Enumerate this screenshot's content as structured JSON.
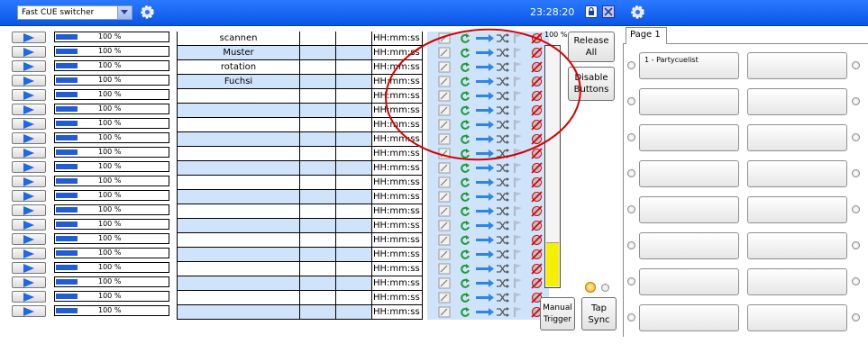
{
  "header": {
    "mode_select_value": "Fast CUE switcher",
    "clock": "23:28:20",
    "icons": [
      "settings-gear-icon",
      "lock-icon",
      "close-icon",
      "settings-gear-icon"
    ],
    "bar_color": "#1560f0"
  },
  "cue_rows": [
    {
      "volume_percent": 100,
      "volume_label": "100  %",
      "name": "scannen",
      "time": "HH:mm:ss"
    },
    {
      "volume_percent": 100,
      "volume_label": "100  %",
      "name": "Muster",
      "time": "HH:mm:ss"
    },
    {
      "volume_percent": 100,
      "volume_label": "100  %",
      "name": "rotation",
      "time": "HH:mm:ss"
    },
    {
      "volume_percent": 100,
      "volume_label": "100  %",
      "name": "Fuchsi",
      "time": "HH:mm:ss"
    },
    {
      "volume_percent": 100,
      "volume_label": "100  %",
      "name": "",
      "time": "HH:mm:ss"
    },
    {
      "volume_percent": 100,
      "volume_label": "100  %",
      "name": "",
      "time": "HH:mm:ss"
    },
    {
      "volume_percent": 100,
      "volume_label": "100  %",
      "name": "",
      "time": "HH:mm:ss"
    },
    {
      "volume_percent": 100,
      "volume_label": "100  %",
      "name": "",
      "time": "HH:mm:ss"
    },
    {
      "volume_percent": 100,
      "volume_label": "100  %",
      "name": "",
      "time": "HH:mm:ss"
    },
    {
      "volume_percent": 100,
      "volume_label": "100  %",
      "name": "",
      "time": "HH:mm:ss"
    },
    {
      "volume_percent": 100,
      "volume_label": "100  %",
      "name": "",
      "time": "HH:mm:ss"
    },
    {
      "volume_percent": 100,
      "volume_label": "100  %",
      "name": "",
      "time": "HH:mm:ss"
    },
    {
      "volume_percent": 100,
      "volume_label": "100  %",
      "name": "",
      "time": "HH:mm:ss"
    },
    {
      "volume_percent": 100,
      "volume_label": "100  %",
      "name": "",
      "time": "HH:mm:ss"
    },
    {
      "volume_percent": 100,
      "volume_label": "100  %",
      "name": "",
      "time": "HH:mm:ss"
    },
    {
      "volume_percent": 100,
      "volume_label": "100  %",
      "name": "",
      "time": "HH:mm:ss"
    },
    {
      "volume_percent": 100,
      "volume_label": "100  %",
      "name": "",
      "time": "HH:mm:ss"
    },
    {
      "volume_percent": 100,
      "volume_label": "100  %",
      "name": "",
      "time": "HH:mm:ss"
    },
    {
      "volume_percent": 100,
      "volume_label": "100  %",
      "name": "",
      "time": "HH:mm:ss"
    },
    {
      "volume_percent": 100,
      "volume_label": "100  %",
      "name": "",
      "time": "HH:mm:ss"
    }
  ],
  "row_icons": [
    "edit-icon",
    "refresh-icon",
    "forward-arrow-icon",
    "shuffle-icon",
    "flag-icon",
    "disable-icon"
  ],
  "master": {
    "level_label": "100 %",
    "level_fraction": 0.18,
    "release_all_label": [
      "Release",
      "All"
    ],
    "disable_buttons_label": [
      "Disable",
      "Buttons"
    ],
    "manual_trigger_label": [
      "Manual",
      "Trigger"
    ],
    "tap_sync_label": [
      "Tap",
      "Sync"
    ]
  },
  "cuelists": {
    "tab_label": "Page 1",
    "buttons": [
      [
        "1 - Partycuelist",
        ""
      ],
      [
        "",
        ""
      ],
      [
        "",
        ""
      ],
      [
        "",
        ""
      ],
      [
        "",
        ""
      ],
      [
        "",
        ""
      ],
      [
        "",
        ""
      ],
      [
        "",
        ""
      ]
    ]
  },
  "colors": {
    "blue_row": "#cfe3fb",
    "level_fill": "#f5f000",
    "annotation_circle": "#d40000"
  }
}
